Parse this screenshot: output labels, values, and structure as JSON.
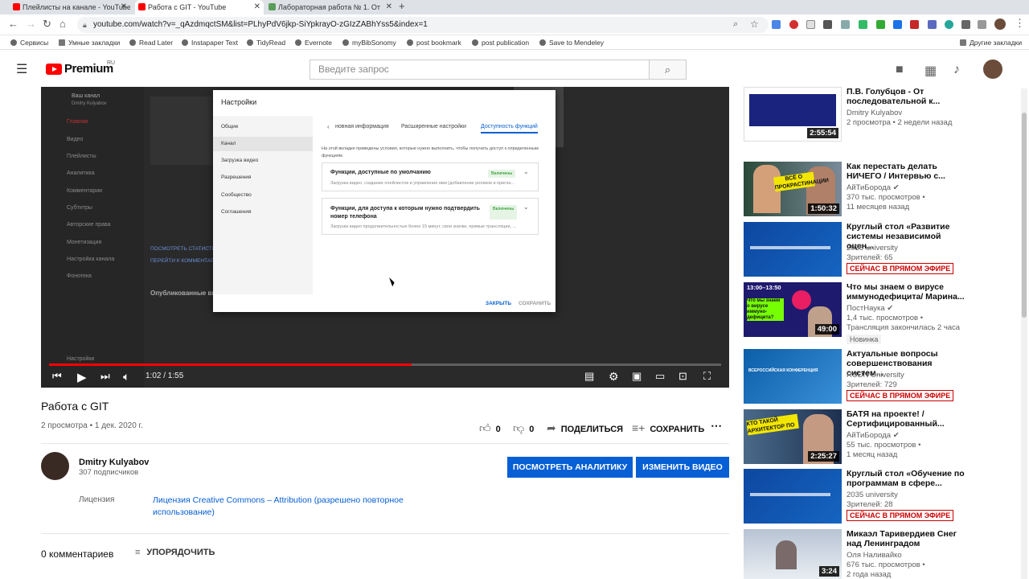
{
  "browser": {
    "tabs": [
      {
        "label": "Плейлисты на канале - YouTube",
        "active": false
      },
      {
        "label": "Работа с GIT - YouTube",
        "active": true
      },
      {
        "label": "Лабораторная работа № 1. От",
        "active": false
      }
    ],
    "url": "youtube.com/watch?v=_qAzdmqctSM&list=PLhyPdV6jkp-SiYpkrayO-zGIzZABhYss5&index=1",
    "bookmarks": [
      "Сервисы",
      "Умные закладки",
      "Read Later",
      "Instapaper Text",
      "TidyRead",
      "Evernote",
      "myBibSonomy",
      "post bookmark",
      "post publication",
      "Save to Mendeley"
    ],
    "other_bookmarks": "Другие закладки"
  },
  "header": {
    "logo_text": "Premium",
    "logo_region": "RU",
    "search_placeholder": "Введите запрос"
  },
  "player": {
    "studio": {
      "channel": "Ваш канал",
      "channel_owner": "Dmitry Kulyabov",
      "nav": [
        "Главная",
        "Видео",
        "Плейлисты",
        "Аналитика",
        "Комментарии",
        "Субтитры",
        "Авторские права",
        "Монетизация",
        "Настройка канала",
        "Фонотека"
      ],
      "settings": "Настройки",
      "section_published": "Опубликованные видео",
      "link_stats": "ПОСМОТРЕТЬ СТАТИСТИ",
      "link_comments": "ПЕРЕЙТИ К КОММЕНТАР"
    },
    "dialog": {
      "title": "Настройки",
      "side": [
        "Общие",
        "Канал",
        "Загрузка видео",
        "Разрешения",
        "Сообщество",
        "Соглашения"
      ],
      "active_side": "Канал",
      "tabs": [
        "новная информация",
        "Расширенные настройки",
        "Доступность функций"
      ],
      "active_tab": "Доступность функций",
      "intro": "На этой вкладке приведены условия, которые нужно выполнить, чтобы получить доступ к определенным функциям.",
      "card1_title": "Функции, доступные по умолчанию",
      "card1_sub": "Загрузка видео, создание плейлистов и управление ими (добавление роликов и пригла...",
      "card1_badge": "Включены",
      "card2_title": "Функции, для доступа к которым нужно подтвердить номер телефона",
      "card2_sub": "Загрузка видео продолжительностью более 15 минут, свои значки, прямые трансляции, ...",
      "card2_badge": "Включены",
      "close": "ЗАКРЫТЬ",
      "save": "СОХРАНИТЬ"
    },
    "time": "1:02 / 1:55",
    "progress": 0.54
  },
  "video": {
    "title": "Работа с GIT",
    "meta": "2 просмотра • 1 дек. 2020 г.",
    "likes": "0",
    "dislikes": "0",
    "share": "ПОДЕЛИТЬСЯ",
    "save": "СОХРАНИТЬ",
    "more": "⋯"
  },
  "channel": {
    "name": "Dmitry Kulyabov",
    "subs": "307 подписчиков",
    "btn_analytics": "ПОСМОТРЕТЬ АНАЛИТИКУ",
    "btn_edit": "ИЗМЕНИТЬ ВИДЕО",
    "license_label": "Лицензия",
    "license_value": "Лицензия Creative Commons – Attribution (разрешено повторное использование)"
  },
  "comments": {
    "count": "0 комментариев",
    "sort": "УПОРЯДОЧИТЬ"
  },
  "recommendations": [
    {
      "title": "П.В. Голубцов - От последовательной к...",
      "channel": "Dmitry Kulyabov",
      "meta": "2 просмотра • 2 недели назад",
      "duration": "2:55:54",
      "thumb": "lecture"
    },
    {
      "title": "Как перестать делать НИЧЕГО / Интервью с...",
      "channel": "АйТиБорода",
      "meta": "370 тыс. просмотров •",
      "meta2": "11 месяцев назад",
      "duration": "1:50:32",
      "thumb": "interview",
      "thumb_text": "ВСЁ О ПРОКРАСТИНАЦИИ",
      "verified": true
    },
    {
      "title": "Круглый стол «Развитие системы независимой оцен...",
      "channel": "2035 university",
      "meta": "Зрителей: 65",
      "live": "СЕЙЧАС В ПРЯМОМ ЭФИРЕ",
      "thumb": "conf"
    },
    {
      "title": "Что мы знаем о вирусе иммунодефицита/ Марина...",
      "channel": "ПостНаука",
      "meta": "1,4 тыс. просмотров •",
      "meta2": "Трансляция закончилась 2 часа",
      "tag": "Новинка",
      "duration": "49:00",
      "thumb": "virus",
      "thumb_time": "13:00–13:50",
      "thumb_text": "Что мы знаем о вирусе иммуно-дефицита?",
      "verified": true
    },
    {
      "title": "Актуальные вопросы совершенствования систем...",
      "channel": "RUDN University",
      "meta": "Зрителей: 729",
      "live": "СЕЙЧАС В ПРЯМОМ ЭФИРЕ",
      "thumb": "rudn",
      "thumb_text": "ВСЕРОССИЙСКАЯ КОНФЕРЕНЦИЯ"
    },
    {
      "title": "БАТЯ на проекте! / Сертифицированный...",
      "channel": "АйТиБорода",
      "meta": "55 тыс. просмотров •",
      "meta2": "1 месяц назад",
      "duration": "2:25:27",
      "thumb": "arch",
      "thumb_text": "КТО ТАКОЙ АРХИТЕКТОР ПО",
      "verified": true
    },
    {
      "title": "Круглый стол «Обучение по программам в сфере...",
      "channel": "2035 university",
      "meta": "Зрителей: 28",
      "live": "СЕЙЧАС В ПРЯМОМ ЭФИРЕ",
      "thumb": "conf"
    },
    {
      "title": "Микаэл Таривердиев Снег над Ленинградом",
      "channel": "Оля Наливайко",
      "meta": "676 тыс. просмотров •",
      "meta2": "2 года назад",
      "duration": "3:24",
      "thumb": "snow"
    }
  ]
}
